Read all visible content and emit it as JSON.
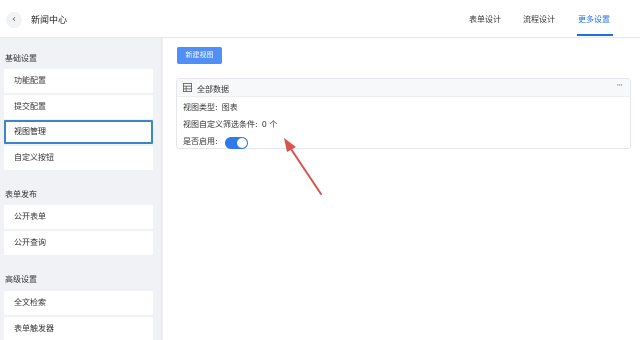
{
  "header": {
    "back_icon": "chevron-left-icon",
    "title": "新闻中心",
    "tabs": [
      {
        "label": "表单设计",
        "active": false
      },
      {
        "label": "流程设计",
        "active": false
      },
      {
        "label": "更多设置",
        "active": true
      }
    ]
  },
  "sidebar": {
    "groups": [
      {
        "title": "基础设置",
        "items": [
          "功能配置",
          "提交配置",
          "视图管理",
          "自定义按钮"
        ]
      },
      {
        "title": "表单发布",
        "items": [
          "公开表单",
          "公开查询"
        ]
      },
      {
        "title": "高级设置",
        "items": [
          "全文检索",
          "表单触发器"
        ]
      }
    ],
    "active_item": "视图管理"
  },
  "main": {
    "new_view_button": "新建视图",
    "card": {
      "title": "全部数据",
      "more": "···",
      "view_type_label": "视图类型:",
      "view_type_value": "图表",
      "filter_label": "视图自定义筛选条件:",
      "filter_value": "0 个",
      "enabled_label": "是否启用:",
      "enabled": true
    }
  },
  "colors": {
    "accent": "#1e6fe6",
    "button": "#4f8ff7",
    "toggle": "#3079e8",
    "active_border": "#3a86c8",
    "annotation_arrow": "#d9534f"
  }
}
